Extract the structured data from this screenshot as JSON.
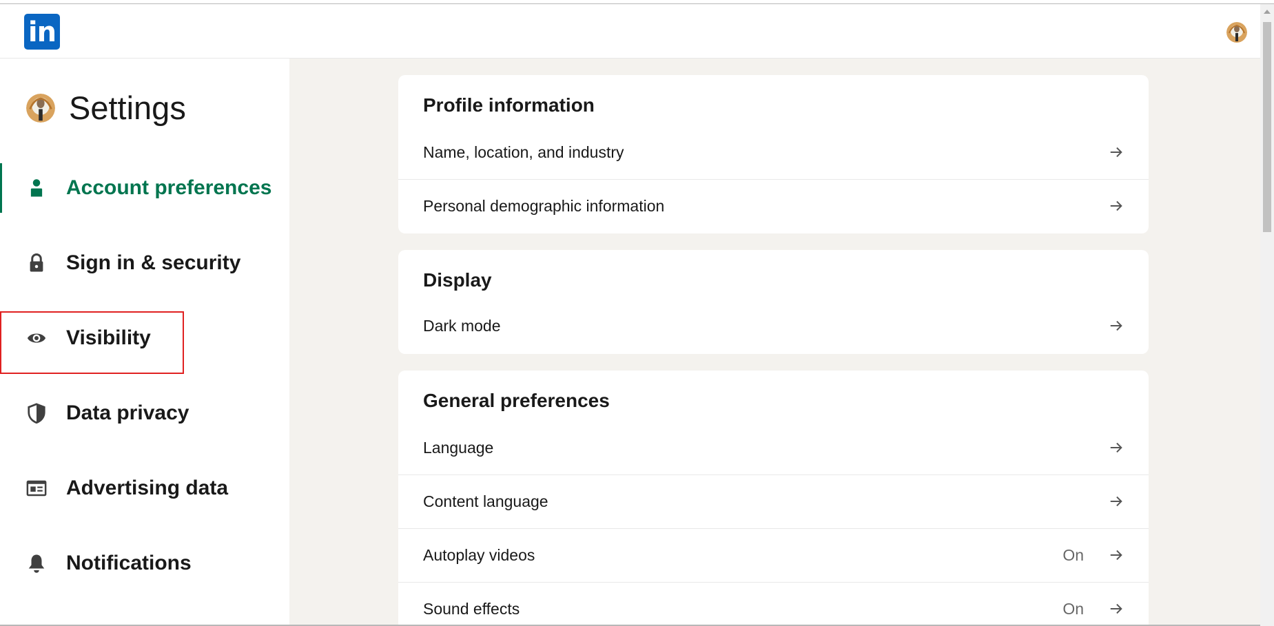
{
  "header": {
    "logo_text": "in"
  },
  "sidebar": {
    "title": "Settings",
    "items": [
      {
        "label": "Account preferences",
        "icon": "person-icon",
        "active": true
      },
      {
        "label": "Sign in & security",
        "icon": "lock-icon"
      },
      {
        "label": "Visibility",
        "icon": "eye-icon"
      },
      {
        "label": "Data privacy",
        "icon": "shield-icon"
      },
      {
        "label": "Advertising data",
        "icon": "newspaper-icon"
      },
      {
        "label": "Notifications",
        "icon": "bell-icon"
      }
    ]
  },
  "main": {
    "profile": {
      "title": "Profile information",
      "rows": [
        {
          "label": "Name, location, and industry",
          "value": ""
        },
        {
          "label": "Personal demographic information",
          "value": ""
        }
      ]
    },
    "display": {
      "title": "Display",
      "rows": [
        {
          "label": "Dark mode",
          "value": ""
        }
      ]
    },
    "general": {
      "title": "General preferences",
      "rows": [
        {
          "label": "Language",
          "value": ""
        },
        {
          "label": "Content language",
          "value": ""
        },
        {
          "label": "Autoplay videos",
          "value": "On"
        },
        {
          "label": "Sound effects",
          "value": "On"
        }
      ]
    }
  },
  "colors": {
    "brand": "#0a66c2",
    "active": "#01754f",
    "background": "#f4f2ee",
    "highlight": "#e02020"
  }
}
